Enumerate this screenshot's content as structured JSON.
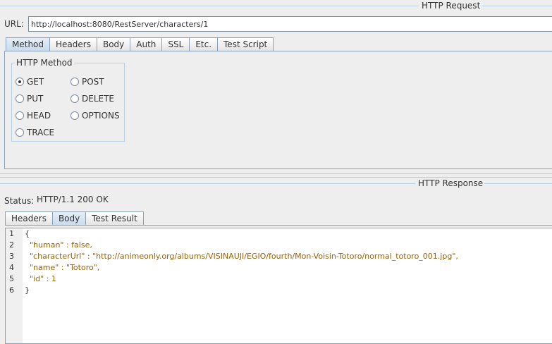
{
  "request": {
    "title": "HTTP Request",
    "url_label": "URL:",
    "url_value": "http://localhost:8080/RestServer/characters/1",
    "tabs": [
      "Method",
      "Headers",
      "Body",
      "Auth",
      "SSL",
      "Etc.",
      "Test Script"
    ],
    "active_tab": "Method",
    "method_group_title": "HTTP Method",
    "methods": [
      {
        "label": "GET",
        "selected": true
      },
      {
        "label": "POST",
        "selected": false
      },
      {
        "label": "PUT",
        "selected": false
      },
      {
        "label": "DELETE",
        "selected": false
      },
      {
        "label": "HEAD",
        "selected": false
      },
      {
        "label": "OPTIONS",
        "selected": false
      },
      {
        "label": "TRACE",
        "selected": false
      }
    ]
  },
  "response": {
    "title": "HTTP Response",
    "status_label": "Status:",
    "status_value": "HTTP/1.1 200 OK",
    "tabs": [
      "Headers",
      "Body",
      "Test Result"
    ],
    "active_tab": "Body",
    "line_numbers": [
      "1",
      "2",
      "3",
      "4",
      "5",
      "6"
    ],
    "body_lines": [
      "{",
      "  \"human\" : false,",
      "  \"characterUrl\" : \"http://animeonly.org/albums/VISINAUJI/EGIO/fourth/Mon-Voisin-Totoro/normal_totoro_001.jpg\",",
      "  \"name\" : \"Totoro\",",
      "  \"id\" : 1",
      "}"
    ]
  }
}
